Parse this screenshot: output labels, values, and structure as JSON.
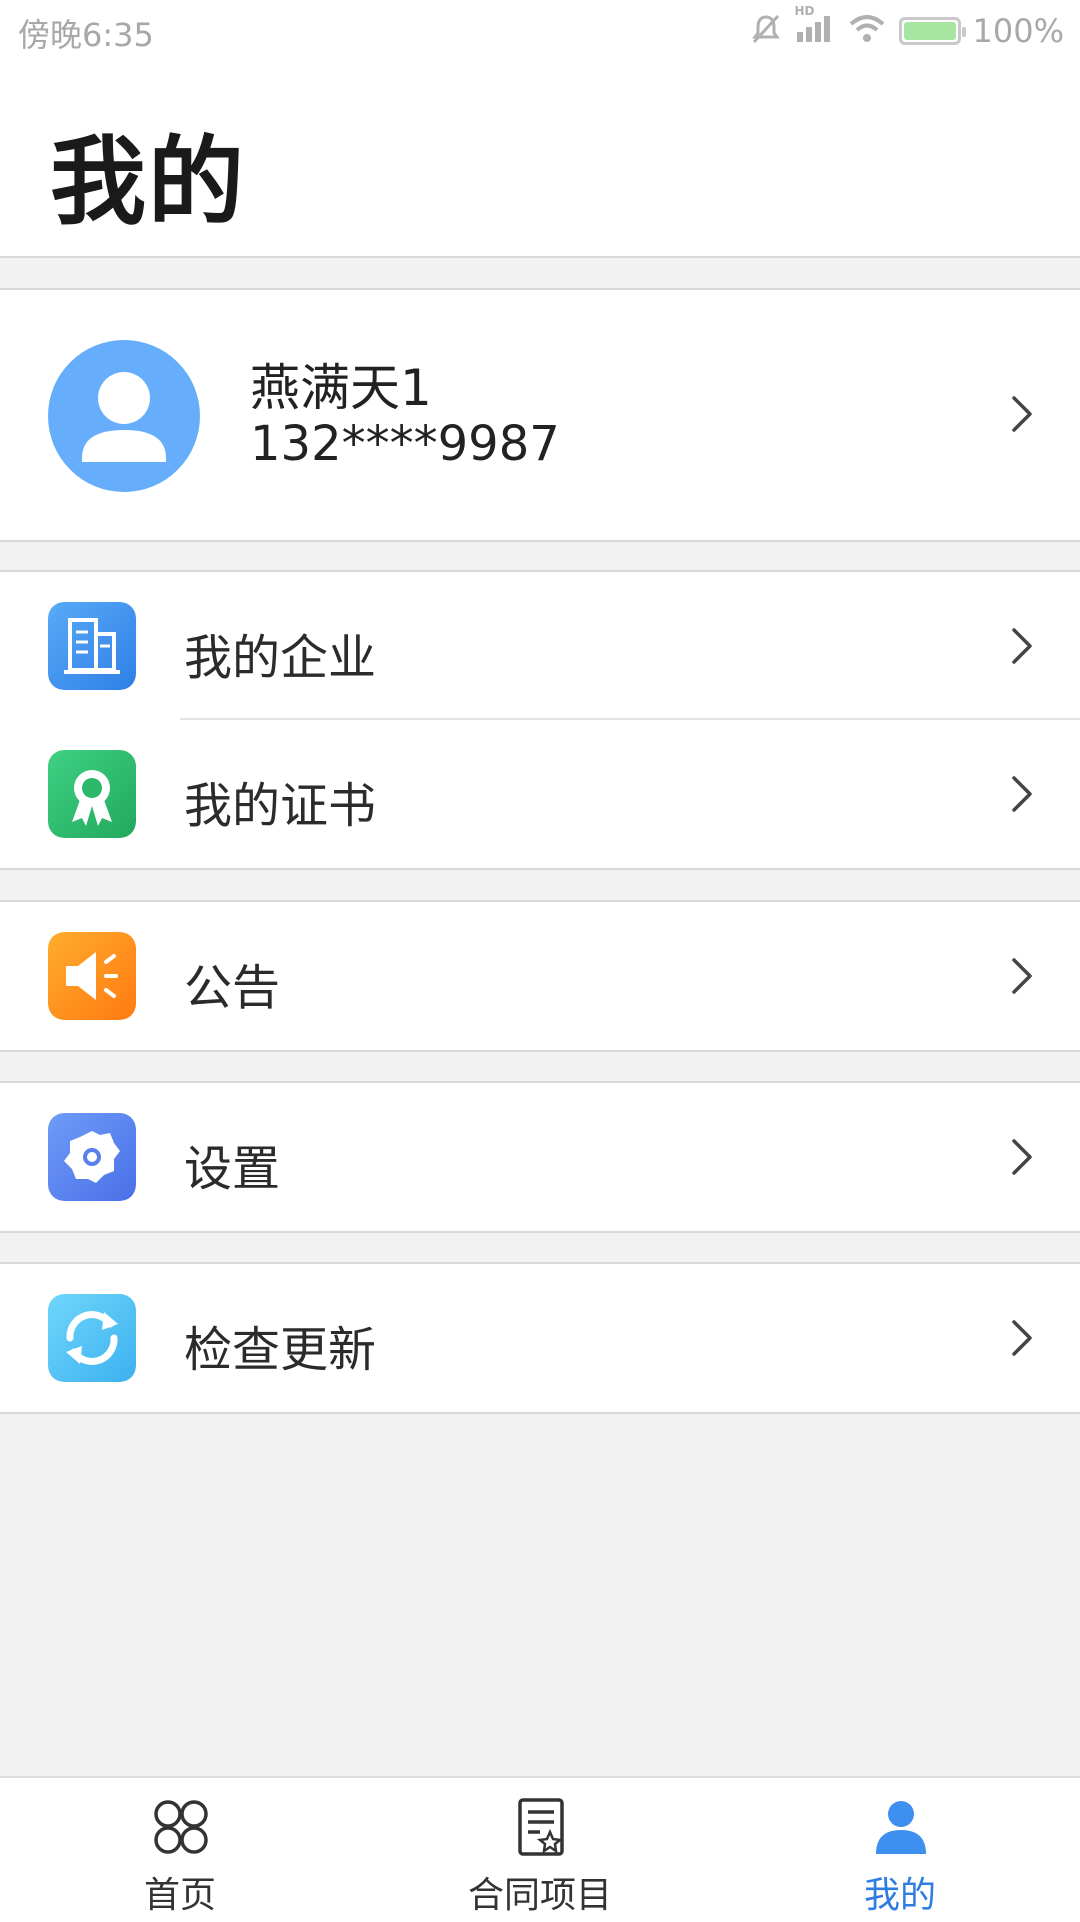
{
  "status_bar": {
    "time": "傍晚6:35",
    "network": "HD",
    "battery_percent": "100%",
    "battery_level": 1.0
  },
  "header": {
    "title": "我的"
  },
  "profile": {
    "name": "燕满天1",
    "phone": "132****9987"
  },
  "menu": {
    "enterprise": "我的企业",
    "certificate": "我的证书",
    "notice": "公告",
    "settings": "设置",
    "check_update": "检查更新"
  },
  "tabs": [
    {
      "label": "首页",
      "icon": "home-grid-icon",
      "active": false
    },
    {
      "label": "合同项目",
      "icon": "contract-document-icon",
      "active": false
    },
    {
      "label": "我的",
      "icon": "person-icon",
      "active": true
    }
  ],
  "colors": {
    "accent": "#2f7de1",
    "avatar_bg": "#66aefb",
    "enterprise_icon": "#3d8ff0",
    "certificate_icon": "#2fbf71",
    "notice_icon": "#ff8a1c",
    "settings_icon": "#5b84f2",
    "update_icon": "#52c3f5"
  }
}
